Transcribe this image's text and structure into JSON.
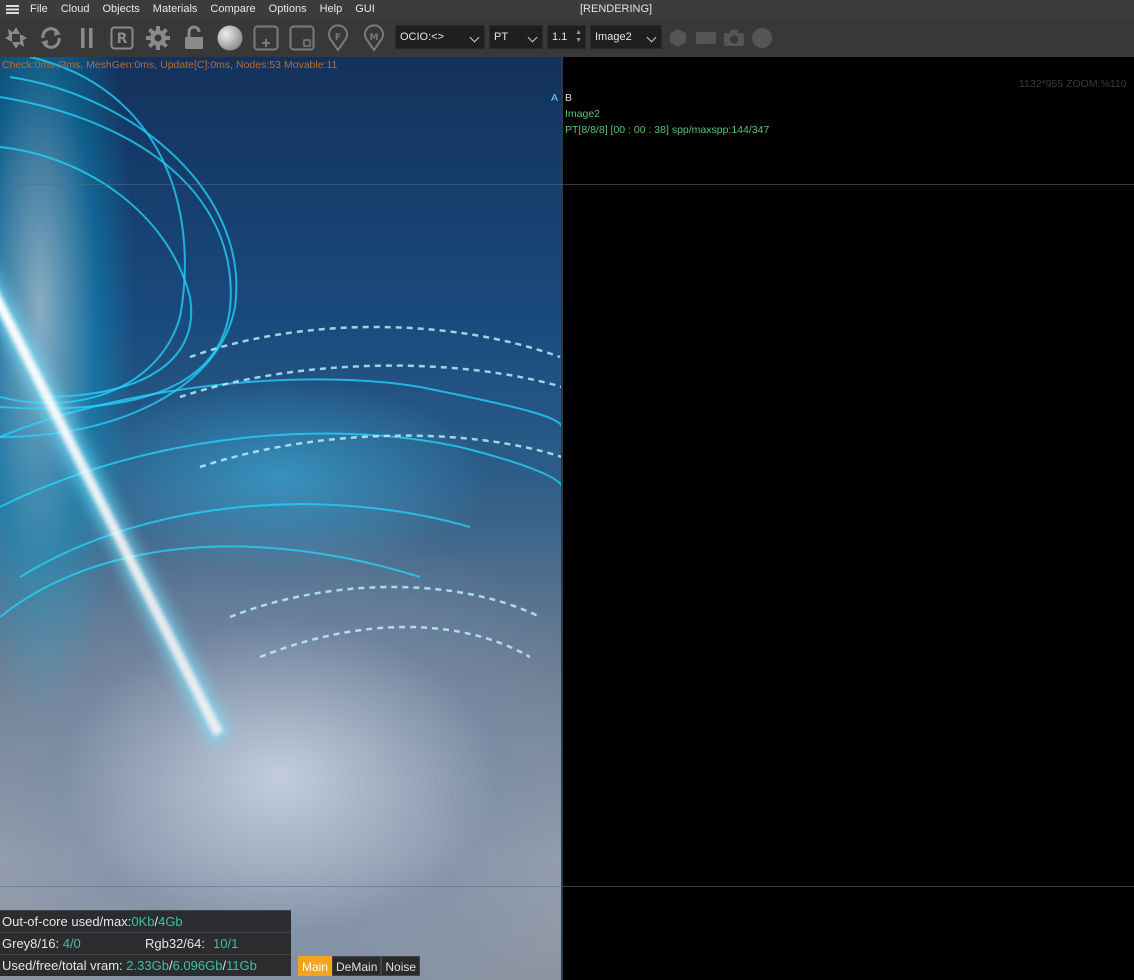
{
  "menubar": {
    "items": [
      "File",
      "Cloud",
      "Objects",
      "Materials",
      "Compare",
      "Options",
      "Help",
      "GUI"
    ],
    "window_title": "[RENDERING]"
  },
  "toolbar": {
    "icons": [
      "aperture-icon",
      "refresh-icon",
      "pause-icon",
      "r-box-icon",
      "gear-icon",
      "unlock-icon",
      "sphere-icon",
      "add-region-icon",
      "region-icon",
      "f-pin-icon",
      "m-pin-icon",
      "hexagon-icon",
      "rect-icon",
      "camera-icon",
      "circle-icon"
    ],
    "ocio_select": "OCIO:<>",
    "kernel_select": "PT",
    "value_spinner": "1.1",
    "image_select": "Image2"
  },
  "viewport": {
    "stats_line": "Check:0ms./3ms, MeshGen:0ms, Update[C]:0ms, Nodes:53 Movable:11",
    "resolution_zoom": "1132*955 ZOOM:%110",
    "compare_a": "A",
    "compare_b": "B",
    "image_label": "Image2",
    "progress_info": "PT[8/8/8] [00 : 00 : 38] spp/maxspp:144/347"
  },
  "info_panel": {
    "out_of_core_label": "Out-of-core used/max:",
    "out_of_core_used": "0Kb",
    "sep1": "/",
    "out_of_core_max": "4Gb",
    "grey_label": "Grey8/16:",
    "grey_value": "4/0",
    "rgb_label": "Rgb32/64:",
    "rgb_value": "10/1",
    "vram_label": "Used/free/total vram:",
    "vram_used": "2.33Gb",
    "vram_free": "6.096Gb",
    "vram_total": "11Gb",
    "sep": "/"
  },
  "buffer_tabs": [
    "Main",
    "DeMain",
    "Noise"
  ],
  "colors": {
    "accent_orange": "#f3a41c",
    "value_green": "#3ec0a0",
    "stats_orange": "#c06a2a",
    "info_green": "#59c46e"
  }
}
